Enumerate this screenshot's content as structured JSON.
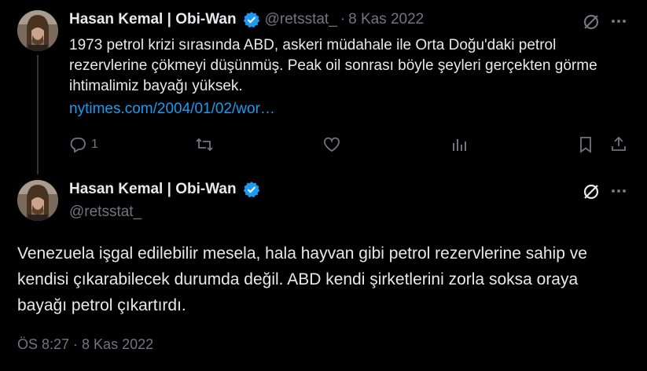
{
  "tweet1": {
    "author_name": "Hasan Kemal | Obi-Wan",
    "handle": "@retsstat_",
    "separator": "·",
    "date": "8 Kas 2022",
    "text": "1973 petrol krizi sırasında ABD, askeri müdahale ile Orta Doğu'daki petrol rezervlerine çökmeyi düşünmüş. Peak oil sonrası böyle şeyleri gerçekten görme ihtimalimiz bayağı yüksek.",
    "link": "nytimes.com/2004/01/02/wor…",
    "reply_count": "1"
  },
  "tweet2": {
    "author_name": "Hasan Kemal | Obi-Wan",
    "handle": "@retsstat_",
    "text": "Venezuela işgal edilebilir mesela, hala hayvan gibi petrol rezervlerine sahip ve kendisi çıkarabilecek durumda değil. ABD kendi şirketlerini zorla soksa oraya bayağı petrol çıkartırdı.",
    "timestamp": "ÖS 8:27 · 8 Kas 2022"
  },
  "colors": {
    "background": "#000000",
    "text": "#e7e9ea",
    "muted": "#71767b",
    "link": "#1d9bf0",
    "verified": "#1d9bf0"
  },
  "icons": [
    "verified-badge-icon",
    "grok-icon",
    "more-icon",
    "reply-icon",
    "retweet-icon",
    "like-icon",
    "views-icon",
    "bookmark-icon",
    "share-icon",
    "avatar-image"
  ]
}
